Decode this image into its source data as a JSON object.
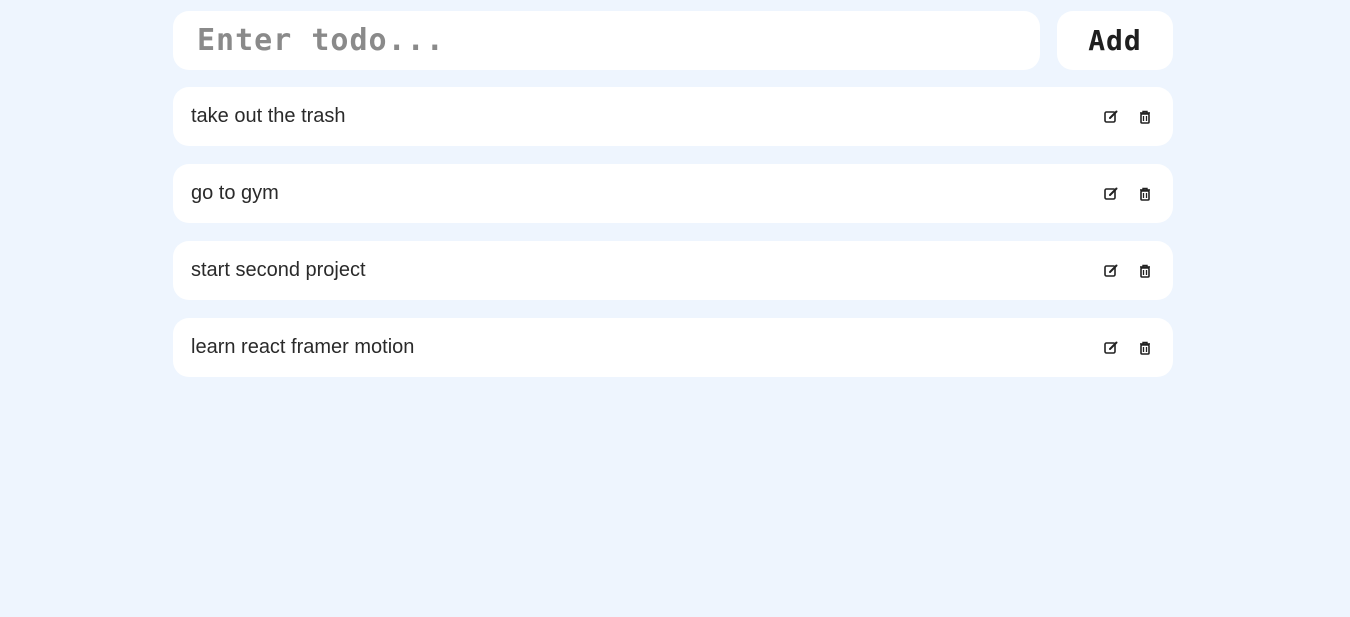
{
  "input": {
    "placeholder": "Enter todo...",
    "value": ""
  },
  "add_button": {
    "label": "Add"
  },
  "todos": [
    {
      "text": "take out the trash",
      "edit_icon": "edit-icon",
      "delete_icon": "trash-icon"
    },
    {
      "text": "go to gym",
      "edit_icon": "edit-icon",
      "delete_icon": "trash-icon"
    },
    {
      "text": "start second project",
      "edit_icon": "edit-icon",
      "delete_icon": "trash-icon"
    },
    {
      "text": "learn react framer motion",
      "edit_icon": "edit-icon",
      "delete_icon": "trash-icon"
    }
  ],
  "colors": {
    "background": "#eef5fe",
    "card": "#ffffff",
    "text": "#2a2a2a",
    "placeholder": "#8a8a8a"
  }
}
